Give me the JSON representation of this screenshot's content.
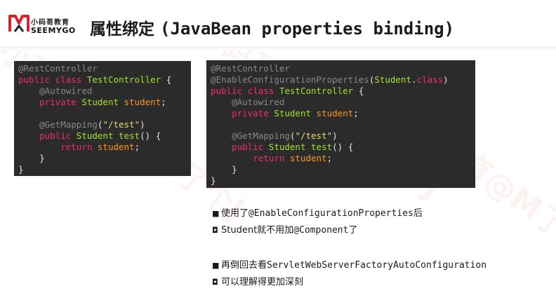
{
  "header": {
    "logo_cn": "小码哥教育",
    "logo_en": "SEEMYGO",
    "title_cn": "属性绑定",
    "title_en": "(JavaBean properties binding)"
  },
  "code_left": [
    [
      [
        "ann",
        "@RestController"
      ]
    ],
    [
      [
        "kw",
        "public class "
      ],
      [
        "cls",
        "TestController"
      ],
      [
        "pn",
        " {"
      ]
    ],
    [
      [
        "pn",
        "    "
      ],
      [
        "ann",
        "@Autowired"
      ]
    ],
    [
      [
        "pn",
        "    "
      ],
      [
        "kw",
        "private "
      ],
      [
        "cls",
        "Student "
      ],
      [
        "var",
        "student"
      ],
      [
        "pn",
        ";"
      ]
    ],
    [
      [
        "pn",
        ""
      ]
    ],
    [
      [
        "pn",
        "    "
      ],
      [
        "ann",
        "@GetMapping"
      ],
      [
        "pn",
        "("
      ],
      [
        "str",
        "\"/test\""
      ],
      [
        "pn",
        ")"
      ]
    ],
    [
      [
        "pn",
        "    "
      ],
      [
        "kw",
        "public "
      ],
      [
        "cls",
        "Student "
      ],
      [
        "cls",
        "test"
      ],
      [
        "pn",
        "() {"
      ]
    ],
    [
      [
        "pn",
        "        "
      ],
      [
        "kw",
        "return "
      ],
      [
        "var",
        "student"
      ],
      [
        "pn",
        ";"
      ]
    ],
    [
      [
        "pn",
        "    }"
      ]
    ],
    [
      [
        "pn",
        "}"
      ]
    ]
  ],
  "code_right": [
    [
      [
        "ann",
        "@RestController"
      ]
    ],
    [
      [
        "ann",
        "@EnableConfigurationProperties"
      ],
      [
        "pn",
        "("
      ],
      [
        "cls",
        "Student"
      ],
      [
        "pn",
        "."
      ],
      [
        "kw",
        "class"
      ],
      [
        "pn",
        ")"
      ]
    ],
    [
      [
        "kw",
        "public class "
      ],
      [
        "cls",
        "TestController"
      ],
      [
        "pn",
        " {"
      ]
    ],
    [
      [
        "pn",
        "    "
      ],
      [
        "ann",
        "@Autowired"
      ]
    ],
    [
      [
        "pn",
        "    "
      ],
      [
        "kw",
        "private "
      ],
      [
        "cls",
        "Student "
      ],
      [
        "var",
        "student"
      ],
      [
        "pn",
        ";"
      ]
    ],
    [
      [
        "pn",
        ""
      ]
    ],
    [
      [
        "pn",
        "    "
      ],
      [
        "ann",
        "@GetMapping"
      ],
      [
        "pn",
        "("
      ],
      [
        "str",
        "\"/test\""
      ],
      [
        "pn",
        ")"
      ]
    ],
    [
      [
        "pn",
        "    "
      ],
      [
        "kw",
        "public "
      ],
      [
        "cls",
        "Student "
      ],
      [
        "cls",
        "test"
      ],
      [
        "pn",
        "() {"
      ]
    ],
    [
      [
        "pn",
        "        "
      ],
      [
        "kw",
        "return "
      ],
      [
        "var",
        "student"
      ],
      [
        "pn",
        ";"
      ]
    ],
    [
      [
        "pn",
        "    }"
      ]
    ],
    [
      [
        "pn",
        "}"
      ]
    ]
  ],
  "bullets": [
    {
      "mark": "■",
      "parts": [
        [
          "t",
          "使用了"
        ],
        [
          "m",
          "@EnableConfigurationProperties"
        ],
        [
          "t",
          "后"
        ]
      ]
    },
    {
      "mark": "◘",
      "parts": [
        [
          "t",
          "Student就不用加"
        ],
        [
          "m",
          "@Component"
        ],
        [
          "t",
          "了"
        ]
      ]
    },
    {
      "mark": "■",
      "parts": [
        [
          "t",
          "再倒回去看"
        ],
        [
          "m",
          "ServletWebServerFactoryAutoConfiguration"
        ]
      ]
    },
    {
      "mark": "◘",
      "parts": [
        [
          "t",
          "可以理解得更加深刻"
        ]
      ]
    }
  ],
  "watermark": "小码哥教育@M了个J",
  "colors": {
    "code_bg": "#2b2b2b",
    "annotation": "#888888",
    "keyword": "#f02c6d",
    "class": "#a6e22e",
    "variable": "#fd971f",
    "string": "#e6db74"
  }
}
